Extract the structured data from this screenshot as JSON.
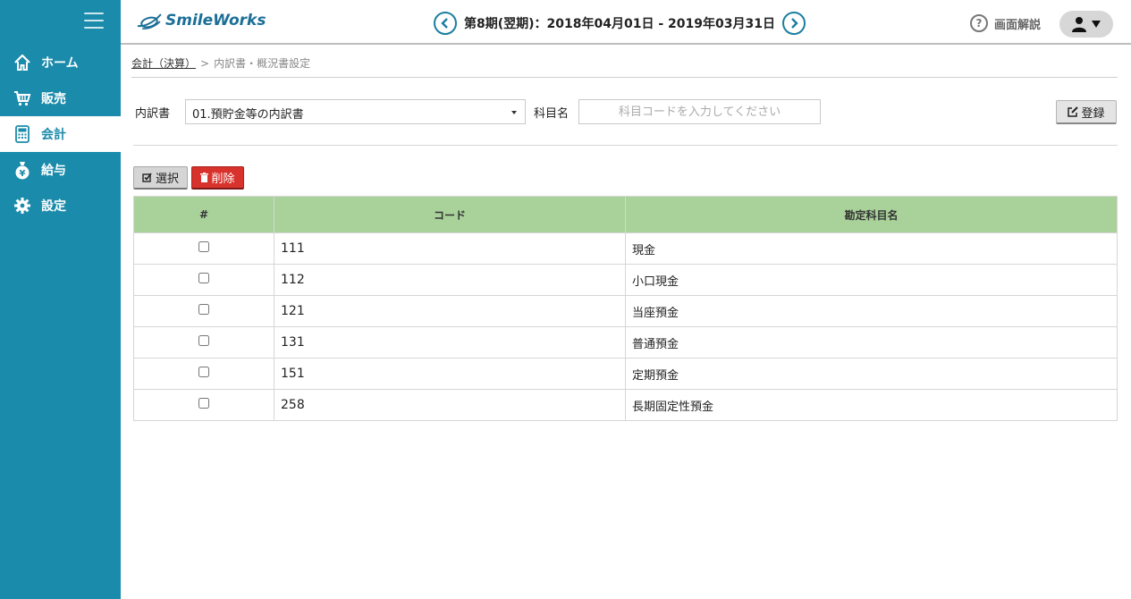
{
  "app": {
    "brand": "SmileWorks"
  },
  "sidebar": {
    "items": [
      {
        "label": "ホーム",
        "icon": "home-icon"
      },
      {
        "label": "販売",
        "icon": "cart-icon"
      },
      {
        "label": "会計",
        "icon": "calculator-icon",
        "active": true
      },
      {
        "label": "給与",
        "icon": "money-bag-icon"
      },
      {
        "label": "設定",
        "icon": "gear-icon"
      }
    ]
  },
  "header": {
    "period": "第8期(翌期)：2018年04月01日 - 2019年03月31日",
    "help_label": "画面解説"
  },
  "breadcrumb": {
    "parent": "会計（決算）",
    "separator": ">",
    "current": "内訳書・概況書設定"
  },
  "form": {
    "statement_label": "内訳書",
    "statement_value": "01.預貯金等の内訳書",
    "account_label": "科目名",
    "account_placeholder": "科目コードを入力してください",
    "register_label": "登録"
  },
  "actions": {
    "select_label": "選択",
    "delete_label": "削除"
  },
  "table": {
    "columns": [
      "#",
      "コード",
      "勘定科目名"
    ],
    "rows": [
      {
        "code": "111",
        "name": "現金"
      },
      {
        "code": "112",
        "name": "小口現金"
      },
      {
        "code": "121",
        "name": "当座預金"
      },
      {
        "code": "131",
        "name": "普通預金"
      },
      {
        "code": "151",
        "name": "定期預金"
      },
      {
        "code": "258",
        "name": "長期固定性預金"
      }
    ]
  },
  "colors": {
    "sidebar": "#1b8bab",
    "table_header": "#a8d29a",
    "delete": "#d8322c"
  }
}
